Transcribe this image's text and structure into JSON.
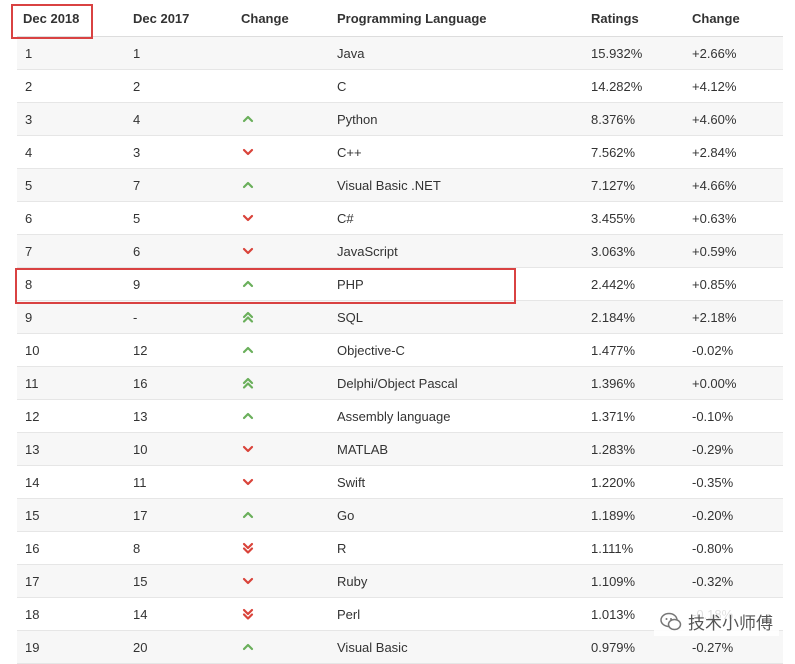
{
  "headers": [
    "Dec 2018",
    "Dec 2017",
    "Change",
    "Programming Language",
    "Ratings",
    "Change"
  ],
  "rows": [
    {
      "now": "1",
      "prev": "1",
      "trend": "none",
      "lang": "Java",
      "rating": "15.932%",
      "delta": "+2.66%"
    },
    {
      "now": "2",
      "prev": "2",
      "trend": "none",
      "lang": "C",
      "rating": "14.282%",
      "delta": "+4.12%"
    },
    {
      "now": "3",
      "prev": "4",
      "trend": "up",
      "lang": "Python",
      "rating": "8.376%",
      "delta": "+4.60%"
    },
    {
      "now": "4",
      "prev": "3",
      "trend": "down",
      "lang": "C++",
      "rating": "7.562%",
      "delta": "+2.84%"
    },
    {
      "now": "5",
      "prev": "7",
      "trend": "up",
      "lang": "Visual Basic .NET",
      "rating": "7.127%",
      "delta": "+4.66%"
    },
    {
      "now": "6",
      "prev": "5",
      "trend": "down",
      "lang": "C#",
      "rating": "3.455%",
      "delta": "+0.63%"
    },
    {
      "now": "7",
      "prev": "6",
      "trend": "down",
      "lang": "JavaScript",
      "rating": "3.063%",
      "delta": "+0.59%"
    },
    {
      "now": "8",
      "prev": "9",
      "trend": "up",
      "lang": "PHP",
      "rating": "2.442%",
      "delta": "+0.85%"
    },
    {
      "now": "9",
      "prev": "-",
      "trend": "up2",
      "lang": "SQL",
      "rating": "2.184%",
      "delta": "+2.18%"
    },
    {
      "now": "10",
      "prev": "12",
      "trend": "up",
      "lang": "Objective-C",
      "rating": "1.477%",
      "delta": "-0.02%"
    },
    {
      "now": "11",
      "prev": "16",
      "trend": "up2",
      "lang": "Delphi/Object Pascal",
      "rating": "1.396%",
      "delta": "+0.00%"
    },
    {
      "now": "12",
      "prev": "13",
      "trend": "up",
      "lang": "Assembly language",
      "rating": "1.371%",
      "delta": "-0.10%"
    },
    {
      "now": "13",
      "prev": "10",
      "trend": "down",
      "lang": "MATLAB",
      "rating": "1.283%",
      "delta": "-0.29%"
    },
    {
      "now": "14",
      "prev": "11",
      "trend": "down",
      "lang": "Swift",
      "rating": "1.220%",
      "delta": "-0.35%"
    },
    {
      "now": "15",
      "prev": "17",
      "trend": "up",
      "lang": "Go",
      "rating": "1.189%",
      "delta": "-0.20%"
    },
    {
      "now": "16",
      "prev": "8",
      "trend": "down2",
      "lang": "R",
      "rating": "1.111%",
      "delta": "-0.80%"
    },
    {
      "now": "17",
      "prev": "15",
      "trend": "down",
      "lang": "Ruby",
      "rating": "1.109%",
      "delta": "-0.32%"
    },
    {
      "now": "18",
      "prev": "14",
      "trend": "down2",
      "lang": "Perl",
      "rating": "1.013%",
      "delta": "-0.18%"
    },
    {
      "now": "19",
      "prev": "20",
      "trend": "up",
      "lang": "Visual Basic",
      "rating": "0.979%",
      "delta": "-0.27%"
    }
  ],
  "colors": {
    "up": "#6aaf5b",
    "down": "#d9433a",
    "highlight": "#d94242"
  },
  "watermark": {
    "text": "技术小师傅",
    "icon": "wechat-icon"
  }
}
